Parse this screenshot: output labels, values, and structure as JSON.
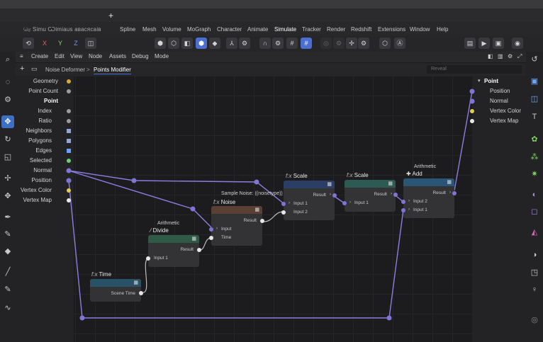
{
  "title_strip": {
    "plus": "+"
  },
  "menubar": {
    "items": [
      "(obscured)",
      "Spline",
      "Mesh",
      "Volume",
      "MoGraph",
      "Character",
      "Animate",
      "Simulate",
      "Tracker",
      "Render",
      "Redshift",
      "Extensions",
      "Window",
      "Help"
    ],
    "obscured_label": "ரெ Ѕimu Ѡimiaus авасясаів"
  },
  "axes": {
    "x": "X",
    "y": "Y",
    "z": "Z"
  },
  "node_menu": [
    "Create",
    "Edit",
    "View",
    "Node",
    "Assets",
    "Debug",
    "Mode"
  ],
  "breadcrumb": {
    "parent": "Noise Deformer",
    "sep": ">",
    "current": "Points Modifier"
  },
  "reveal_placeholder": "Reveal",
  "inputs": {
    "geometry": "Geometry",
    "point_count": "Point Count",
    "point": "Point",
    "index": "Index",
    "ratio": "Ratio",
    "neighbors": "Neighbors",
    "polygons": "Polygons",
    "edges": "Edges",
    "selected": "Selected",
    "normal": "Normal",
    "position": "Position",
    "vertex_color": "Vertex Color",
    "vertex_map": "Vertex Map"
  },
  "outputs": {
    "title": "Point",
    "position": "Position",
    "normal": "Normal",
    "vertex_color": "Vertex Color",
    "vertex_map": "Vertex Map"
  },
  "nodes": {
    "time": {
      "fx": "f:x",
      "name": "Time",
      "out": "Scene Time"
    },
    "divide": {
      "group": "Arithmetic",
      "name": "Divide",
      "out": "Result",
      "in1": "Input 1"
    },
    "noise": {
      "sample": "Sample Noise: ((noisetype))",
      "fx": "f:x",
      "name": "Noise",
      "out": "Result",
      "in_input": "Input",
      "in_time": "Time"
    },
    "scale1": {
      "fx": "f:x",
      "name": "Scale",
      "out": "Result",
      "in1": "Input 1",
      "in2": "Input 2"
    },
    "scale2": {
      "fx": "f:x",
      "name": "Scale",
      "out": "Result",
      "in1": "Input 1"
    },
    "add": {
      "group": "Arithmetic",
      "name": "Add",
      "out": "Result",
      "in2": "Input 2",
      "in1": "Input 1"
    }
  },
  "colors": {
    "accent": "#4a6ed1",
    "wire": "#8c7ee0",
    "port": "#7f75d6",
    "time_head": "#2a5266",
    "divide_head": "#2f5a46",
    "noise_head": "#5a3f33",
    "scale_head": "#2b3f66",
    "scale2_head": "#2d5a52",
    "add_head": "#2b5575"
  }
}
